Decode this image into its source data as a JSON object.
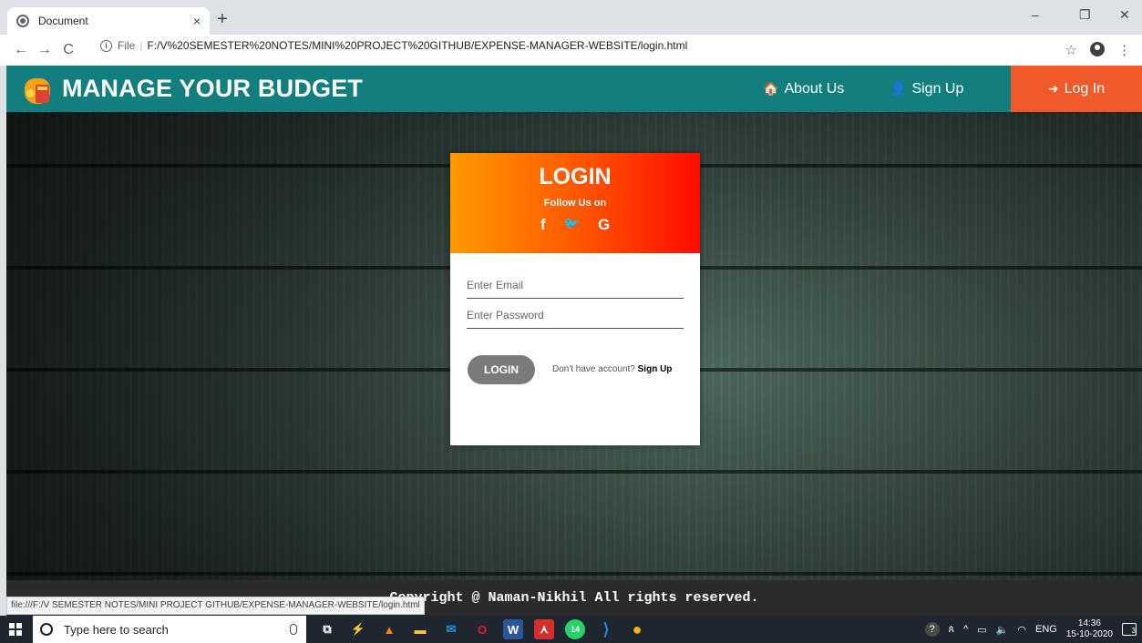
{
  "browser": {
    "tab_title": "Document",
    "tab_close": "×",
    "new_tab": "+",
    "window_controls": [
      "–",
      "❐",
      "✕"
    ],
    "nav": {
      "back": "←",
      "forward": "→",
      "reload": "C"
    },
    "omnibox": {
      "info_glyph": "i",
      "scheme": "File",
      "separator": "|",
      "url": "F:/V%20SEMESTER%20NOTES/MINI%20PROJECT%20GITHUB/EXPENSE-MANAGER-WEBSITE/login.html"
    },
    "star_glyph": "☆",
    "menu_glyph": "⋮",
    "status_url": "file:///F:/V SEMESTER NOTES/MINI PROJECT GITHUB/EXPENSE-MANAGER-WEBSITE/login.html"
  },
  "navbar": {
    "brand": "MANAGE YOUR BUDGET",
    "about": {
      "icon": "home-icon",
      "glyph": "🏠",
      "label": "About Us"
    },
    "signup": {
      "icon": "user-plus-icon",
      "glyph": "👤",
      "label": "Sign Up"
    },
    "login": {
      "icon": "sign-in-icon",
      "glyph": "➜",
      "label": "Log In"
    },
    "color": "#137e7e",
    "active_color": "#f05a2b"
  },
  "login_card": {
    "title": "LOGIN",
    "follow": "Follow Us on",
    "social": {
      "facebook": "f",
      "twitter": "🐦",
      "google": "G"
    },
    "email_placeholder": "Enter Email",
    "password_placeholder": "Enter Password",
    "button": "LOGIN",
    "no_account": "Don't have account?",
    "signup_link": "Sign Up",
    "gradient": [
      "#ff9a00",
      "#ff0b00"
    ]
  },
  "footer": {
    "copyright": "Copyright @ Naman-Nikhil All rights reserved."
  },
  "taskbar": {
    "search_placeholder": "Type here to search",
    "apps": [
      {
        "name": "task-view-icon",
        "glyph": "⧉",
        "color": "#1f2630"
      },
      {
        "name": "lightning-app-icon",
        "glyph": "⚡",
        "color": "#1f2630"
      },
      {
        "name": "vlc-icon",
        "glyph": "▲",
        "color": "#1f2630"
      },
      {
        "name": "file-explorer-icon",
        "glyph": "▬",
        "color": "#f2c744"
      },
      {
        "name": "mail-icon",
        "glyph": "✉",
        "color": "#1e90d6"
      },
      {
        "name": "opera-icon",
        "glyph": "O",
        "color": "#e0212c"
      },
      {
        "name": "word-icon",
        "glyph": "W",
        "color": "#2b579a"
      },
      {
        "name": "acrobat-icon",
        "glyph": "⋏",
        "color": "#d32f2f"
      },
      {
        "name": "whatsapp-icon",
        "glyph": "14",
        "color": "#25d366"
      },
      {
        "name": "vscode-icon",
        "glyph": "⟩",
        "color": "#1f8ad2"
      },
      {
        "name": "chrome-icon",
        "glyph": "●",
        "color": "#f4b400"
      }
    ],
    "tray": {
      "help_glyph": "?",
      "people_glyph": "ጰ",
      "chevron": "^",
      "battery_glyph": "▭",
      "volume_glyph": "🔈",
      "wifi_glyph": "◠",
      "lang": "ENG",
      "time": "14:36",
      "date": "15-10-2020",
      "notifications": "3"
    }
  }
}
